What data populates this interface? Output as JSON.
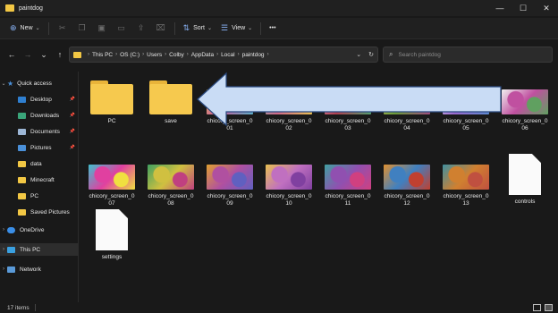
{
  "window": {
    "title": "paintdog",
    "min_glyph": "—",
    "max_glyph": "☐",
    "close_glyph": "✕"
  },
  "toolbar": {
    "new_label": "New",
    "new_icon": "⊕",
    "cut_icon": "✂",
    "copy_icon": "❐",
    "paste_icon": "📋",
    "rename_icon": "▭",
    "share_icon": "⇪",
    "delete_icon": "🗑",
    "sort_label": "Sort",
    "sort_icon": "⇅",
    "view_label": "View",
    "view_icon": "☰",
    "more_glyph": "•••",
    "dropdown_glyph": "⌄"
  },
  "nav": {
    "back": "←",
    "forward": "→",
    "recent": "⌄",
    "up": "↑"
  },
  "address": {
    "crumbs": [
      "This PC",
      "OS (C:)",
      "Users",
      "Colby",
      "AppData",
      "Local",
      "paintdog"
    ],
    "crumb_sep": "›",
    "dropdown": "⌄",
    "refresh": "↻"
  },
  "search": {
    "placeholder": "Search paintdog",
    "icon": "⌕"
  },
  "sidebar": {
    "quick_access": "Quick access",
    "items": [
      {
        "label": "Desktop",
        "icon": "desktop-icon",
        "pinned": true,
        "color": "#2f7fd0"
      },
      {
        "label": "Downloads",
        "icon": "downloads-icon",
        "pinned": true,
        "color": "#3aa57a"
      },
      {
        "label": "Documents",
        "icon": "documents-icon",
        "pinned": true,
        "color": "#9db7d6"
      },
      {
        "label": "Pictures",
        "icon": "pictures-icon",
        "pinned": true,
        "color": "#4a90d9"
      },
      {
        "label": "data",
        "icon": "folder-icon",
        "pinned": false,
        "color": "#f2c744"
      },
      {
        "label": "Minecraft",
        "icon": "folder-icon",
        "pinned": false,
        "color": "#f2c744"
      },
      {
        "label": "PC",
        "icon": "folder-icon",
        "pinned": false,
        "color": "#f2c744"
      },
      {
        "label": "Saved Pictures",
        "icon": "folder-icon",
        "pinned": false,
        "color": "#f2c744"
      }
    ],
    "onedrive": "OneDrive",
    "this_pc": "This PC",
    "network": "Network",
    "pin_glyph": "📌",
    "chevron_open": "⌄",
    "chevron_closed": "›"
  },
  "files": [
    {
      "name": "PC",
      "kind": "folder"
    },
    {
      "name": "save",
      "kind": "folder"
    },
    {
      "name": "chicory_screen_01",
      "kind": "image",
      "colors": [
        "#c85a9b",
        "#f0d04a",
        "#5ab0c8"
      ]
    },
    {
      "name": "chicory_screen_02",
      "kind": "image",
      "colors": [
        "#d06a8a",
        "#6ac0b0",
        "#e8c050"
      ]
    },
    {
      "name": "chicory_screen_03",
      "kind": "image",
      "colors": [
        "#b04050",
        "#e0a0c0",
        "#50a070"
      ]
    },
    {
      "name": "chicory_screen_04",
      "kind": "image",
      "colors": [
        "#6a9a3a",
        "#d0c060",
        "#a04a80"
      ]
    },
    {
      "name": "chicory_screen_05",
      "kind": "image",
      "colors": [
        "#9a6ad0",
        "#e8e0f0",
        "#5a8ad0"
      ]
    },
    {
      "name": "chicory_screen_06",
      "kind": "image",
      "colors": [
        "#c050a0",
        "#f0f0f0",
        "#60a060"
      ]
    },
    {
      "name": "chicory_screen_07",
      "kind": "image",
      "colors": [
        "#e040a0",
        "#40c0d0",
        "#f0e040"
      ]
    },
    {
      "name": "chicory_screen_08",
      "kind": "image",
      "colors": [
        "#d0c040",
        "#40a060",
        "#c04080"
      ]
    },
    {
      "name": "chicory_screen_09",
      "kind": "image",
      "colors": [
        "#b050a0",
        "#e0a030",
        "#6060c0"
      ]
    },
    {
      "name": "chicory_screen_10",
      "kind": "image",
      "colors": [
        "#c070c0",
        "#e8c050",
        "#8040a0"
      ]
    },
    {
      "name": "chicory_screen_11",
      "kind": "image",
      "colors": [
        "#9050b0",
        "#40a0a0",
        "#d04080"
      ]
    },
    {
      "name": "chicory_screen_12",
      "kind": "image",
      "colors": [
        "#4080c0",
        "#e09030",
        "#c04030"
      ]
    },
    {
      "name": "chicory_screen_13",
      "kind": "image",
      "colors": [
        "#d08030",
        "#4090a0",
        "#c05040"
      ]
    },
    {
      "name": "controls",
      "kind": "document"
    },
    {
      "name": "settings",
      "kind": "document"
    }
  ],
  "file_labels": {
    "chicory_screen_01": [
      "chicory_screen_0",
      "01"
    ],
    "chicory_screen_02": [
      "chicory_screen_0",
      "02"
    ],
    "chicory_screen_03": [
      "chicory_screen_0",
      "03"
    ],
    "chicory_screen_04": [
      "chicory_screen_0",
      "04"
    ],
    "chicory_screen_05": [
      "chicory_screen_0",
      "05"
    ],
    "chicory_screen_06": [
      "chicory_screen_0",
      "06"
    ],
    "chicory_screen_07": [
      "chicory_screen_0",
      "07"
    ],
    "chicory_screen_08": [
      "chicory_screen_0",
      "08"
    ],
    "chicory_screen_09": [
      "chicory_screen_0",
      "09"
    ],
    "chicory_screen_10": [
      "chicory_screen_0",
      "10"
    ],
    "chicory_screen_11": [
      "chicory_screen_0",
      "11"
    ],
    "chicory_screen_12": [
      "chicory_screen_0",
      "12"
    ],
    "chicory_screen_13": [
      "chicory_screen_0",
      "13"
    ]
  },
  "annotation": {
    "type": "arrow",
    "color": "#c9dcf5",
    "outline": "#2a4a80",
    "points_to": "save"
  },
  "status": {
    "item_count": "17 items"
  }
}
